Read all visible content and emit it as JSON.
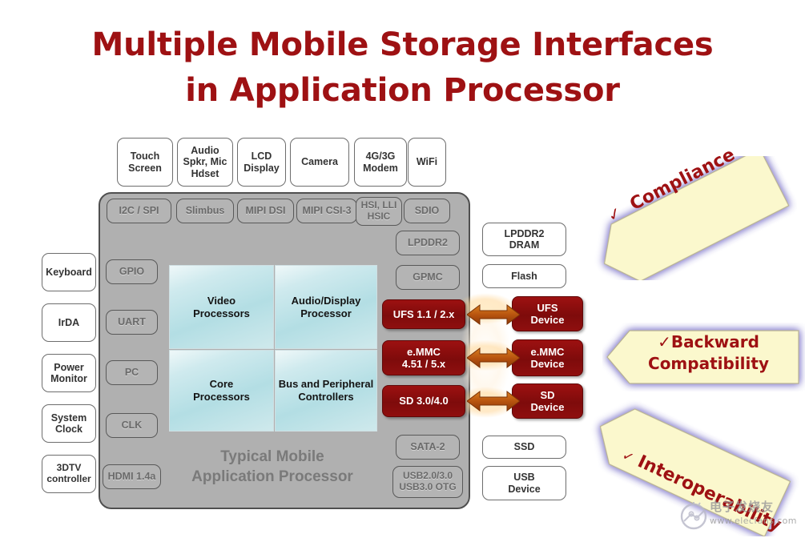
{
  "title": {
    "line1": "Multiple Mobile Storage Interfaces",
    "line2": "in Application Processor",
    "color": "#9E1113"
  },
  "chip": {
    "caption_line1": "Typical Mobile",
    "caption_line2": "Application Processor",
    "body_color": "#b0b0b0"
  },
  "top_peripherals": [
    {
      "label": "Touch\nScreen"
    },
    {
      "label": "Audio\nSpkr, Mic\nHdset"
    },
    {
      "label": "LCD\nDisplay"
    },
    {
      "label": "Camera"
    },
    {
      "label": "4G/3G\nModem"
    },
    {
      "label": "WiFi"
    }
  ],
  "top_interfaces": [
    {
      "label": "I2C / SPI"
    },
    {
      "label": "Slimbus"
    },
    {
      "label": "MIPI DSI"
    },
    {
      "label": "MIPI CSI-3"
    },
    {
      "label": "HSI, LLI\nHSIC"
    },
    {
      "label": "SDIO"
    }
  ],
  "left_peripherals": [
    {
      "label": "Keyboard"
    },
    {
      "label": "IrDA"
    },
    {
      "label": "Power\nMonitor"
    },
    {
      "label": "System\nClock"
    },
    {
      "label": "3DTV\ncontroller"
    }
  ],
  "left_interfaces": [
    {
      "label": "GPIO"
    },
    {
      "label": "UART"
    },
    {
      "label": "PC"
    },
    {
      "label": "CLK"
    },
    {
      "label": "HDMI 1.4a"
    }
  ],
  "core_blocks": [
    {
      "label": "Video\nProcessors"
    },
    {
      "label": "Audio/Display\nProcessor"
    },
    {
      "label": "Core\nProcessors"
    },
    {
      "label": "Bus and Peripheral\nControllers"
    }
  ],
  "right_interfaces": [
    {
      "label": "LPDDR2",
      "style": "gray"
    },
    {
      "label": "GPMC",
      "style": "gray"
    },
    {
      "label": "UFS 1.1 / 2.x",
      "style": "red"
    },
    {
      "label": "e.MMC\n4.51 / 5.x",
      "style": "red"
    },
    {
      "label": "SD 3.0/4.0",
      "style": "red"
    },
    {
      "label": "SATA-2",
      "style": "gray"
    },
    {
      "label": "USB2.0/3.0\nUSB3.0 OTG",
      "style": "gray"
    }
  ],
  "right_devices": [
    {
      "label": "LPDDR2\nDRAM",
      "style": "white"
    },
    {
      "label": "Flash",
      "style": "white"
    },
    {
      "label": "UFS\nDevice",
      "style": "red"
    },
    {
      "label": "e.MMC\nDevice",
      "style": "red"
    },
    {
      "label": "SD\nDevice",
      "style": "red"
    },
    {
      "label": "SSD",
      "style": "white"
    },
    {
      "label": "USB\nDevice",
      "style": "white"
    }
  ],
  "callouts": [
    {
      "check": "✓",
      "text": "Compliance"
    },
    {
      "check": "✓",
      "text_line1": "Backward",
      "text_line2": "Compatibility"
    },
    {
      "check": "✓",
      "text": "Interoperability"
    }
  ],
  "watermark": {
    "text": "电子发烧友",
    "url": "www.elecfans.com"
  },
  "colors": {
    "accent_red": "#9E1113",
    "box_red": "#8f0f0f",
    "chip_gray": "#b0b0b0",
    "interface_gray": "#b4b4b4",
    "core_blue": "#b3dee4",
    "banner_yellow": "#fbf8cd",
    "banner_glow": "#9a93d6",
    "arrow_orange": "#c8651a"
  }
}
